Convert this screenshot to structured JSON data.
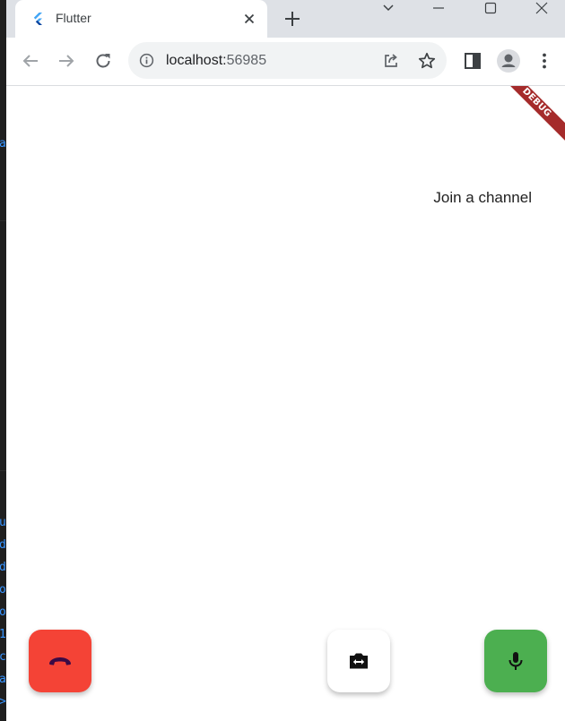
{
  "browser": {
    "tab_title": "Flutter",
    "url_host": "localhost:",
    "url_port": "56985"
  },
  "app": {
    "status_text": "Join a channel",
    "debug_banner": "DEBUG"
  },
  "colors": {
    "end_call": "#f44336",
    "mic": "#4caf50",
    "switch_camera": "#ffffff",
    "debug_banner": "#a52b2b"
  },
  "background_window": {
    "visible_chars": [
      "a",
      "u",
      "d",
      "d",
      "o",
      "o",
      "1",
      "c",
      "a",
      ">"
    ]
  }
}
